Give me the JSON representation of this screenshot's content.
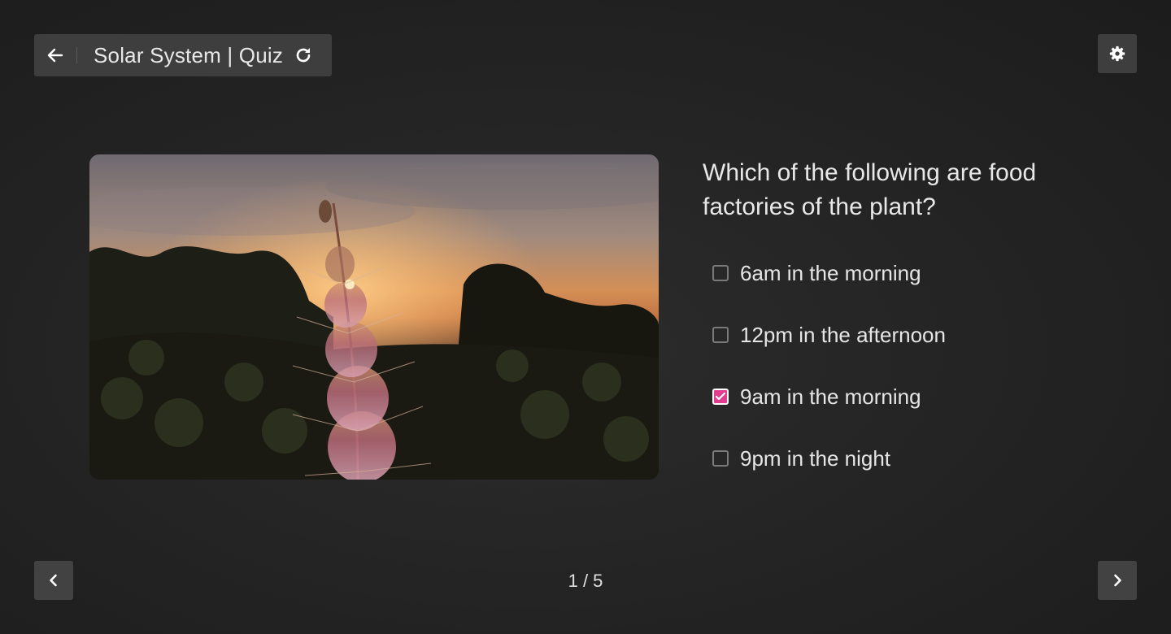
{
  "header": {
    "back_icon": "arrow-left-icon",
    "title": "Solar System | Quiz",
    "reload_icon": "refresh-icon",
    "settings_icon": "gear-icon"
  },
  "question": {
    "text": "Which of the following are food factories of the plant?",
    "options": [
      {
        "label": "6am in the morning",
        "checked": false
      },
      {
        "label": "12pm in the afternoon",
        "checked": false
      },
      {
        "label": "9am in the morning",
        "checked": true
      },
      {
        "label": "9pm in the night",
        "checked": false
      }
    ]
  },
  "pagination": {
    "label": "1 / 5",
    "prev_icon": "chevron-left-icon",
    "next_icon": "chevron-right-icon"
  },
  "colors": {
    "accent": "#e23d8e",
    "background": "#242424",
    "button_bg": "#3e3e3e"
  }
}
